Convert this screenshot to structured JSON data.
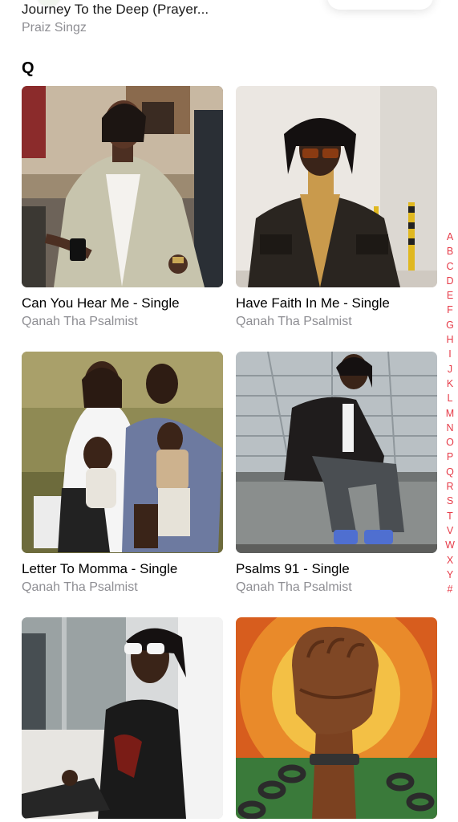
{
  "previous_item": {
    "title": "Journey To the Deep (Prayer...",
    "artist": "Praiz Singz"
  },
  "section": {
    "letter": "Q"
  },
  "albums": [
    {
      "title": "Can You Hear Me - Single",
      "artist": "Qanah Tha Psalmist"
    },
    {
      "title": "Have Faith In Me - Single",
      "artist": "Qanah Tha Psalmist"
    },
    {
      "title": "Letter To Momma - Single",
      "artist": "Qanah Tha Psalmist"
    },
    {
      "title": "Psalms 91 - Single",
      "artist": "Qanah Tha Psalmist"
    },
    {
      "title": "",
      "artist": ""
    },
    {
      "title": "",
      "artist": ""
    }
  ],
  "alphabet_index": [
    "A",
    "B",
    "C",
    "D",
    "E",
    "F",
    "G",
    "H",
    "I",
    "J",
    "K",
    "L",
    "M",
    "N",
    "O",
    "P",
    "Q",
    "R",
    "S",
    "T",
    "V",
    "W",
    "X",
    "Y",
    "#"
  ],
  "colors": {
    "accent": "#e63b48",
    "secondary_text": "#8e8e93"
  }
}
